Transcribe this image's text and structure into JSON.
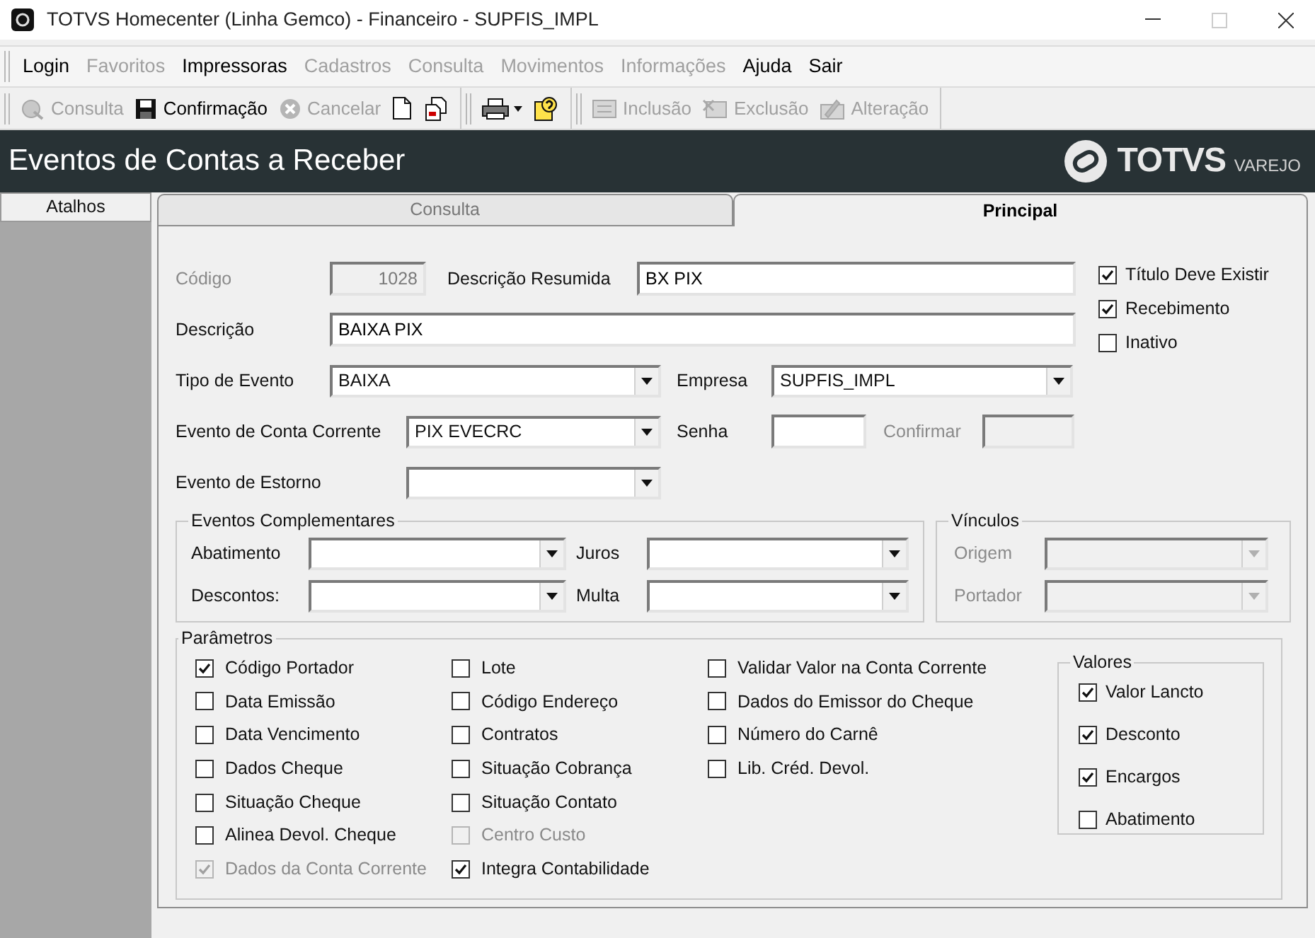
{
  "window": {
    "title": "TOTVS Homecenter (Linha Gemco) - Financeiro - SUPFIS_IMPL"
  },
  "menu": [
    {
      "label": "Login",
      "disabled": false
    },
    {
      "label": "Favoritos",
      "disabled": true
    },
    {
      "label": "Impressoras",
      "disabled": false
    },
    {
      "label": "Cadastros",
      "disabled": true
    },
    {
      "label": "Consulta",
      "disabled": true
    },
    {
      "label": "Movimentos",
      "disabled": true
    },
    {
      "label": "Informações",
      "disabled": true
    },
    {
      "label": "Ajuda",
      "disabled": false
    },
    {
      "label": "Sair",
      "disabled": false
    }
  ],
  "toolbar": [
    [
      {
        "kind": "text",
        "label": "Consulta",
        "disabled": true
      },
      {
        "kind": "text",
        "label": "Confirmação",
        "disabled": false
      },
      {
        "kind": "text",
        "label": "Cancelar",
        "disabled": true
      },
      {
        "kind": "icon",
        "disabled": false
      },
      {
        "kind": "icon",
        "disabled": false
      }
    ],
    [
      {
        "kind": "dropdown",
        "disabled": false
      },
      {
        "kind": "icon",
        "disabled": false
      }
    ],
    [
      {
        "kind": "text",
        "label": "Inclusão",
        "disabled": true
      },
      {
        "kind": "text",
        "label": "Exclusão",
        "disabled": true
      },
      {
        "kind": "text",
        "label": "Alteração",
        "disabled": true
      }
    ]
  ],
  "header": {
    "title": "Eventos de Contas a Receber",
    "logo": "TOTVS",
    "logo_tag": "VAREJO"
  },
  "sidebar": {
    "button": "Atalhos"
  },
  "tabs": [
    {
      "label": "Consulta",
      "selected": false
    },
    {
      "label": "Principal",
      "selected": true
    }
  ],
  "form": {
    "codigo": {
      "label": "Código",
      "value": "1028",
      "disabled": true
    },
    "descricao_resumida": {
      "label": "Descrição Resumida",
      "value": "BX PIX",
      "disabled": false
    },
    "descricao": {
      "label": "Descrição",
      "value": "BAIXA PIX",
      "disabled": false
    },
    "tipo_evento": {
      "label": "Tipo de Evento",
      "value": "BAIXA",
      "disabled": false
    },
    "empresa": {
      "label": "Empresa",
      "value": "SUPFIS_IMPL",
      "disabled": false
    },
    "evento_conta_corrente": {
      "label": "Evento de Conta Corrente",
      "value": "PIX EVECRC",
      "disabled": false
    },
    "senha": {
      "label": "Senha",
      "disabled": false
    },
    "confirmar": {
      "label": "Confirmar",
      "disabled": true
    },
    "evento_estorno": {
      "label": "Evento de Estorno",
      "disabled": false
    }
  },
  "flags": [
    {
      "label": "Título Deve Existir",
      "checked": true,
      "disabled": false
    },
    {
      "label": "Recebimento",
      "checked": true,
      "disabled": false
    },
    {
      "label": "Inativo",
      "checked": false,
      "disabled": false
    }
  ],
  "eventos_complementares": {
    "title": "Eventos Complementares",
    "fields": [
      {
        "label": "Abatimento",
        "disabled": false
      },
      {
        "label": "Juros",
        "disabled": false
      },
      {
        "label": "Descontos:",
        "disabled": false
      },
      {
        "label": "Multa",
        "disabled": false
      }
    ]
  },
  "vinculos": {
    "title": "Vínculos",
    "fields": [
      {
        "label": "Origem",
        "disabled": true
      },
      {
        "label": "Portador",
        "disabled": true
      }
    ]
  },
  "parametros": {
    "title": "Parâmetros",
    "columns": [
      [
        {
          "label": "Código Portador",
          "checked": true,
          "disabled": false
        },
        {
          "label": "Data Emissão",
          "checked": false,
          "disabled": false
        },
        {
          "label": "Data Vencimento",
          "checked": false,
          "disabled": false
        },
        {
          "label": "Dados Cheque",
          "checked": false,
          "disabled": false
        },
        {
          "label": "Situação Cheque",
          "checked": false,
          "disabled": false
        },
        {
          "label": "Alinea Devol. Cheque",
          "checked": false,
          "disabled": false
        },
        {
          "label": "Dados da Conta Corrente",
          "checked": true,
          "disabled": true
        }
      ],
      [
        {
          "label": "Lote",
          "checked": false,
          "disabled": false
        },
        {
          "label": "Código Endereço",
          "checked": false,
          "disabled": false
        },
        {
          "label": "Contratos",
          "checked": false,
          "disabled": false
        },
        {
          "label": "Situação Cobrança",
          "checked": false,
          "disabled": false
        },
        {
          "label": "Situação Contato",
          "checked": false,
          "disabled": false
        },
        {
          "label": "Centro Custo",
          "checked": false,
          "disabled": true
        },
        {
          "label": "Integra Contabilidade",
          "checked": true,
          "disabled": false
        }
      ],
      [
        {
          "label": "Validar Valor na Conta Corrente",
          "checked": false,
          "disabled": false
        },
        {
          "label": "Dados do Emissor do Cheque",
          "checked": false,
          "disabled": false
        },
        {
          "label": "Número do Carnê",
          "checked": false,
          "disabled": false
        },
        {
          "label": "Lib. Créd. Devol.",
          "checked": false,
          "disabled": false
        }
      ]
    ],
    "valores": {
      "title": "Valores",
      "items": [
        {
          "label": "Valor Lancto",
          "checked": true,
          "disabled": false
        },
        {
          "label": "Desconto",
          "checked": true,
          "disabled": false
        },
        {
          "label": "Encargos",
          "checked": true,
          "disabled": false
        },
        {
          "label": "Abatimento",
          "checked": false,
          "disabled": false
        }
      ]
    }
  }
}
